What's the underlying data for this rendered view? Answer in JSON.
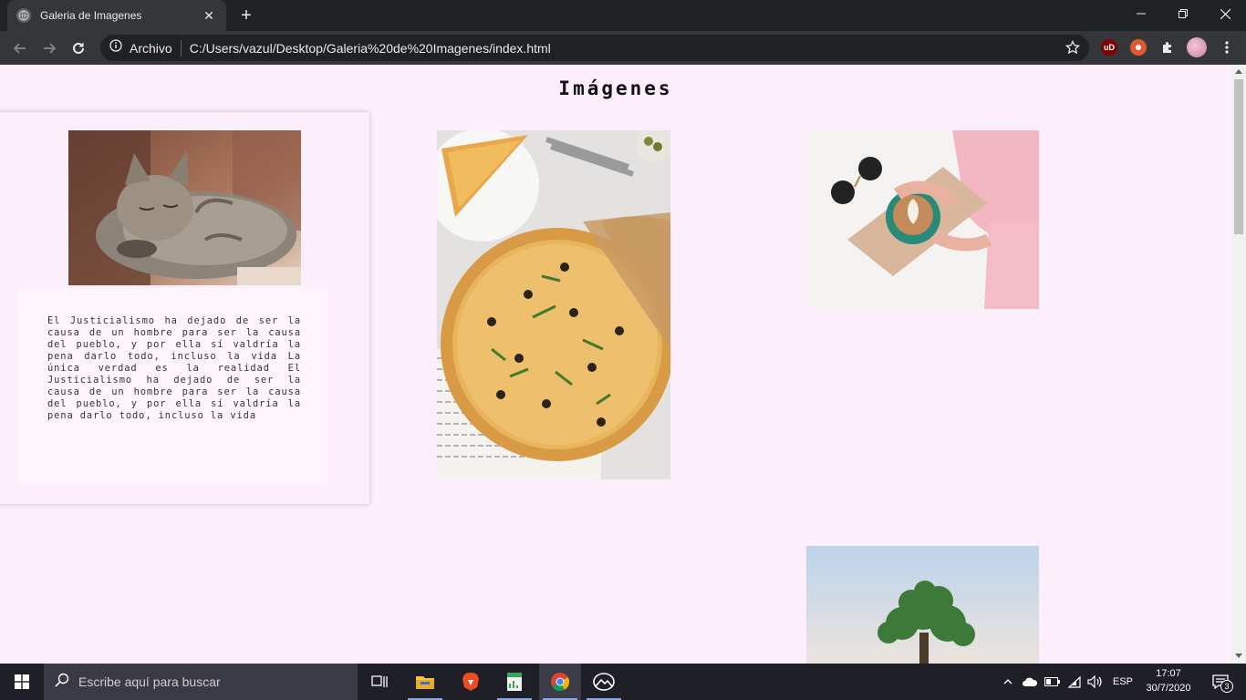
{
  "browser": {
    "tab_title": "Galeria de Imagenes",
    "tab_close": "✕",
    "new_tab": "+",
    "scheme_label": "Archivo",
    "url": "C:/Users/vazul/Desktop/Galeria%20de%20Imagenes/index.html",
    "extensions": [
      "ublock-icon",
      "duckduckgo-icon",
      "extensions-puzzle-icon",
      "profile-avatar"
    ]
  },
  "page": {
    "title": "Imágenes",
    "card_text": "El Justicialismo ha dejado de ser la causa de un hombre para ser la causa del pueblo, y por ella sí valdría la pena darlo todo, incluso la vida La única verdad es la realidad El Justicialismo ha dejado de ser la causa de un hombre para ser la causa del pueblo, y por ella sí valdría la pena darlo todo, incluso la vida",
    "images": [
      "sleeping-kitten-photo",
      "pizza-photo",
      "coffee-latte-photo",
      "tree-photo"
    ]
  },
  "taskbar": {
    "search_placeholder": "Escribe aquí para buscar",
    "language": "ESP",
    "time": "17:07",
    "date": "30/7/2020",
    "notifications_count": "3"
  }
}
